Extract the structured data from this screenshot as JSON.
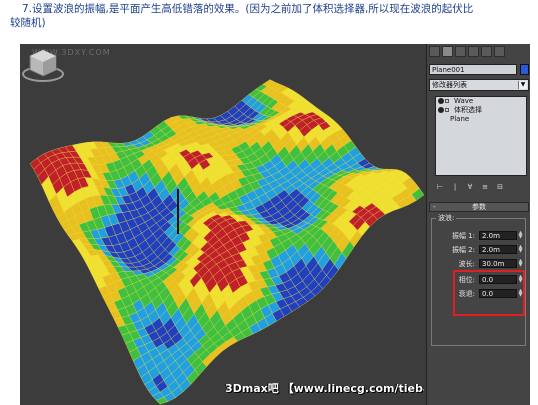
{
  "caption": {
    "line1": "7.设置波浪的振幅,是平面产生高低错落的效果。(因为之前加了体积选择器,所以现在波浪的起伏比",
    "line2": "较随机)"
  },
  "viewport": {
    "watermark_top": "WWW.3DXY.COM",
    "watermark_bottom": "3Dmax吧 【www.linecg.com/tieba/1771】"
  },
  "panel": {
    "object_name": "Plane001",
    "object_color": "#2b5ad8",
    "modifier_list": "修改器列表",
    "stack": [
      {
        "label": "Wave"
      },
      {
        "label": "体积选择"
      },
      {
        "label": "Plane"
      }
    ],
    "rollout_title": "参数",
    "group_title": "波浪:",
    "params": [
      {
        "label": "振幅 1:",
        "value": "2.0m"
      },
      {
        "label": "振幅 2:",
        "value": "2.0m"
      },
      {
        "label": "波长:",
        "value": "30.0m"
      },
      {
        "label": "相位:",
        "value": "0.0"
      },
      {
        "label": "衰退:",
        "value": "0.0"
      }
    ],
    "stack_tools": [
      "⊢",
      "|",
      "∀",
      "≡",
      "⊟"
    ]
  },
  "colors": {
    "viewport_bg": "#3c3c3c",
    "panel_bg": "#444444",
    "highlight": "#e02020"
  }
}
